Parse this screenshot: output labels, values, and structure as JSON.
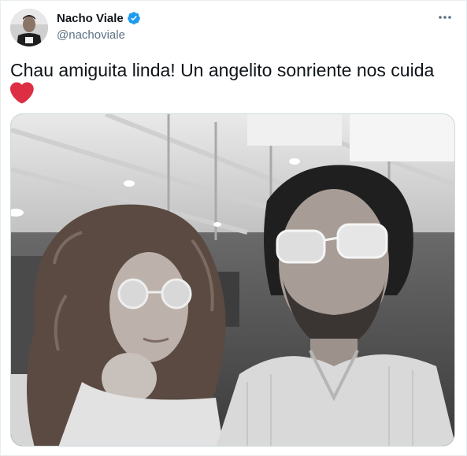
{
  "tweet": {
    "author": {
      "display_name": "Nacho Viale",
      "handle": "@nachoviale",
      "verified": true
    },
    "text": "Chau amiguita linda! Un angelito sonriente nos cuida",
    "emoji": "red-heart",
    "media": {
      "kind": "photo",
      "style": "black-and-white"
    }
  },
  "icons": {
    "verified": "verified-badge-icon",
    "more": "more-options-icon"
  },
  "colors": {
    "verified_blue": "#1d9bf0",
    "heart_red": "#dd2e44",
    "handle_gray": "#5b7083",
    "text": "#0f1419"
  }
}
